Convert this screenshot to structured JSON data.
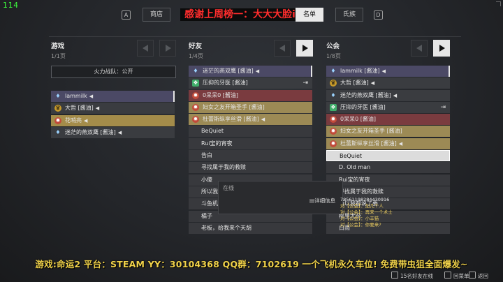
{
  "hud": {
    "fps": "114"
  },
  "topnav": {
    "key_left": "A",
    "store_label": "商店",
    "banner": "感谢上周榜一：大大大脸ii",
    "roster_label": "名单",
    "clan_label": "氏族",
    "key_right": "D"
  },
  "columns": {
    "game": {
      "title": "游戏",
      "page": "1/1页"
    },
    "friends": {
      "title": "好友",
      "page": "1/4页"
    },
    "clan": {
      "title": "公会",
      "page": "1/8页"
    }
  },
  "fireteam": {
    "label": "火力战队：公开"
  },
  "game_list": [
    {
      "name": "lammilk",
      "icon": "flame-icon",
      "style": "purple",
      "voice": true
    },
    {
      "name": "大哲",
      "tag": "[酱油]",
      "icon": "emblem-icon",
      "style": "gray",
      "voice": true
    },
    {
      "name": "花哨亮",
      "icon": "red-emblem-icon",
      "style": "gold",
      "voice": true
    },
    {
      "name": "迷茫的燕双鹰",
      "tag": "[酱油]",
      "icon": "flame-icon",
      "style": "gray",
      "voice": true
    }
  ],
  "friends_list": [
    {
      "name": "迷茫的燕双鹰",
      "tag": "[酱油]",
      "icon": "flame-icon",
      "style": "purple",
      "voice": true
    },
    {
      "name": "压抑的牙医",
      "tag": "[酱油]",
      "icon": "green-emblem-icon",
      "style": "gray",
      "door": true
    },
    {
      "name": "0呆呆0",
      "tag": "[酱油]",
      "icon": "red-emblem-icon",
      "style": "red"
    },
    {
      "name": "妇女之友开箱圣手",
      "tag": "[酱油]",
      "icon": "red-emblem-icon",
      "style": "tan"
    },
    {
      "name": "杜蕾斯纵享丝滑",
      "tag": "[酱油]",
      "icon": "red-emblem-icon",
      "style": "tan",
      "voice": true
    },
    {
      "name": "BeQuiet",
      "style": "dark"
    },
    {
      "name": "Rui宝的宵夜",
      "style": "dark"
    },
    {
      "name": "告白",
      "style": "dark"
    },
    {
      "name": "寻找属于我的救赎",
      "style": "dark"
    },
    {
      "name": "小傻",
      "style": "dark"
    },
    {
      "name": "所以我",
      "style": "dark"
    },
    {
      "name": "斗鱼机长YG-3015080",
      "style": "dark"
    },
    {
      "name": "橘子",
      "style": "dark"
    },
    {
      "name": "老板，给我来个天胡",
      "style": "dark"
    }
  ],
  "clan_list": [
    {
      "name": "lammilk",
      "tag": "[酱油]",
      "icon": "flame-icon",
      "style": "purple",
      "voice": true
    },
    {
      "name": "大哲",
      "tag": "[酱油]",
      "icon": "emblem-icon",
      "style": "gray",
      "voice": true
    },
    {
      "name": "迷茫的燕双鹰",
      "tag": "[酱油]",
      "icon": "flame-icon",
      "style": "gray",
      "voice": true
    },
    {
      "name": "压抑的牙医",
      "tag": "[酱油]",
      "icon": "green-emblem-icon",
      "style": "gray",
      "door": true
    },
    {
      "name": "0呆呆0",
      "tag": "[酱油]",
      "icon": "red-emblem-icon",
      "style": "red"
    },
    {
      "name": "妇女之友开箱圣手",
      "tag": "[酱油]",
      "icon": "red-emblem-icon",
      "style": "tan"
    },
    {
      "name": "杜蕾斯纵享丝滑",
      "tag": "[酱油]",
      "icon": "red-emblem-icon",
      "style": "tan",
      "voice": true
    },
    {
      "name": "BeQuiet",
      "style": "selected"
    },
    {
      "name": "D. Old man",
      "style": "dark"
    },
    {
      "name": "Rui宝的宵夜",
      "style": "dark"
    },
    {
      "name": "寻找属于我的救赎",
      "style": "dark"
    },
    {
      "name": "所以我都说了要",
      "style": "dark"
    },
    {
      "name": "桃里尤奈",
      "style": "dark"
    },
    {
      "name": "白雨",
      "style": "dark"
    }
  ],
  "context_menu": {
    "status": "在线",
    "details": "详细信息"
  },
  "chat": [
    {
      "who": "",
      "text": "78561198284430916",
      "cls": "b"
    },
    {
      "who": "对【公会】：",
      "text": "加几个人",
      "cls": "a"
    },
    {
      "who": "对【公会】：",
      "text": "再来一个术士",
      "cls": "a"
    },
    {
      "who": "对【公会】：",
      "text": "小丰猫",
      "cls": "a"
    },
    {
      "who": "对【公会】：",
      "text": "你要来?",
      "cls": "a"
    }
  ],
  "promo": "游戏:命运2 平台：STEAM YY：30104368 QQ群：7102619 一个飞机永久车位! 免费带虫狙全面爆发~",
  "footer": {
    "online": "15名好友在线",
    "menu": "回菜单",
    "back": "返回"
  }
}
